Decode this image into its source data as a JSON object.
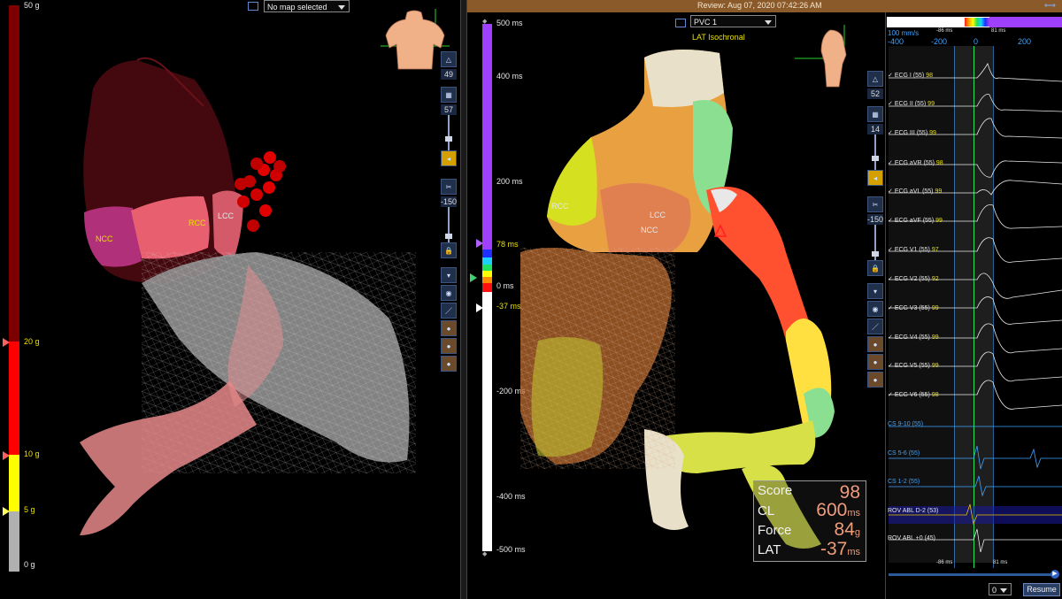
{
  "left_panel": {
    "map_select": {
      "value": "No map selected"
    },
    "force_scale": {
      "ticks": [
        "50 g",
        "20 g",
        "10 g",
        "5 g",
        "0 g"
      ]
    },
    "anatomy_labels": {
      "ncc": "NCC",
      "rcc": "RCC",
      "lcc": "LCC"
    },
    "toolbar": {
      "count1": "49",
      "count2": "57",
      "offset": "-150"
    }
  },
  "middle_panel": {
    "title": "Review: Aug 07, 2020 07:42:26 AM",
    "map_select": {
      "value": "PVC 1"
    },
    "map_subtitle": "LAT Isochronal",
    "lat_scale": {
      "ticks": [
        "500 ms",
        "400 ms",
        "200 ms",
        "78 ms",
        "0 ms",
        "-37 ms",
        "-200 ms",
        "-400 ms",
        "-500 ms"
      ]
    },
    "anatomy_labels": {
      "rcc": "RCC",
      "lcc": "LCC",
      "ncc": "NCC"
    },
    "info_box": {
      "score_label": "Score",
      "score_value": "98",
      "cl_label": "CL",
      "cl_value": "600",
      "cl_unit": "ms",
      "force_label": "Force",
      "force_value": "84",
      "force_unit": "g",
      "lat_label": "LAT",
      "lat_value": "-37",
      "lat_unit": "ms"
    },
    "toolbar": {
      "count1": "52",
      "count2": "14",
      "offset": "-150"
    }
  },
  "right_panel": {
    "speed": "100 mm/s",
    "axis_ticks": [
      "-400",
      "-200",
      "0",
      "200"
    ],
    "window_left": "-86 ms",
    "window_right": "81 ms",
    "ecg_channels": [
      {
        "name": "ECG I (55)",
        "value": "98"
      },
      {
        "name": "ECG II (55)",
        "value": "99"
      },
      {
        "name": "ECG III (55)",
        "value": "99"
      },
      {
        "name": "ECG aVR (55)",
        "value": "98"
      },
      {
        "name": "ECG aVL (55)",
        "value": "99"
      },
      {
        "name": "ECG aVF (55)",
        "value": "99"
      },
      {
        "name": "ECG V1 (55)",
        "value": "97"
      },
      {
        "name": "ECG V2 (55)",
        "value": "92"
      },
      {
        "name": "ECG V3 (55)",
        "value": "99"
      },
      {
        "name": "ECG V4 (55)",
        "value": "99"
      },
      {
        "name": "ECG V5 (55)",
        "value": "99"
      },
      {
        "name": "ECG V6 (55)",
        "value": "98"
      }
    ],
    "cs_channels": [
      "CS 9-10 (55)",
      "CS 5-6 (55)",
      "CS 1-2 (55)"
    ],
    "rov_channels": [
      "ROV ABL D-2 (53)",
      "ROV ABL +0 (45)"
    ],
    "bottom": {
      "select_value": "0",
      "resume_label": "Resume"
    }
  }
}
